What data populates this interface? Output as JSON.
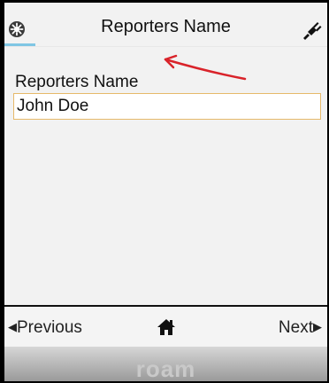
{
  "header": {
    "title": "Reporters Name",
    "left_icon": "menu-gear-icon",
    "right_icon": "plug-icon"
  },
  "form": {
    "field_label": "Reporters Name",
    "field_value": "John Doe"
  },
  "nav": {
    "previous_label": "Previous",
    "home_icon": "home-icon",
    "next_label": "Next"
  },
  "footer": {
    "brand": "roam"
  },
  "colors": {
    "tab_indicator": "#7fc6e4",
    "input_border": "#e6b96a",
    "annotation_arrow": "#d9232a"
  }
}
